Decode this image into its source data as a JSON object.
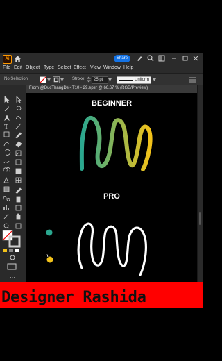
{
  "app": {
    "logo": "Ai",
    "share_label": "Share"
  },
  "menu": [
    "File",
    "Edit",
    "Object",
    "Type",
    "Select",
    "Effect",
    "View",
    "Window",
    "Help"
  ],
  "control_bar": {
    "selection_label": "No Selection",
    "stroke_label": "Stroke:",
    "stroke_value": "25 pt",
    "profile_label": "Uniform"
  },
  "document": {
    "tab_title": "From @DucThangDs - T10 - 29.eps* @ 66.67 % (RGB/Preview)"
  },
  "artboard": {
    "beginner_label": "BEGINNER",
    "pro_label": "PRO"
  },
  "banner": {
    "text": "Designer Rashida"
  },
  "colors": {
    "gradient_start": "#2aa78f",
    "gradient_end": "#f2c21a",
    "banner": "#ff0000",
    "dot_teal": "#2aa78f",
    "dot_yellow": "#f2c21a"
  }
}
